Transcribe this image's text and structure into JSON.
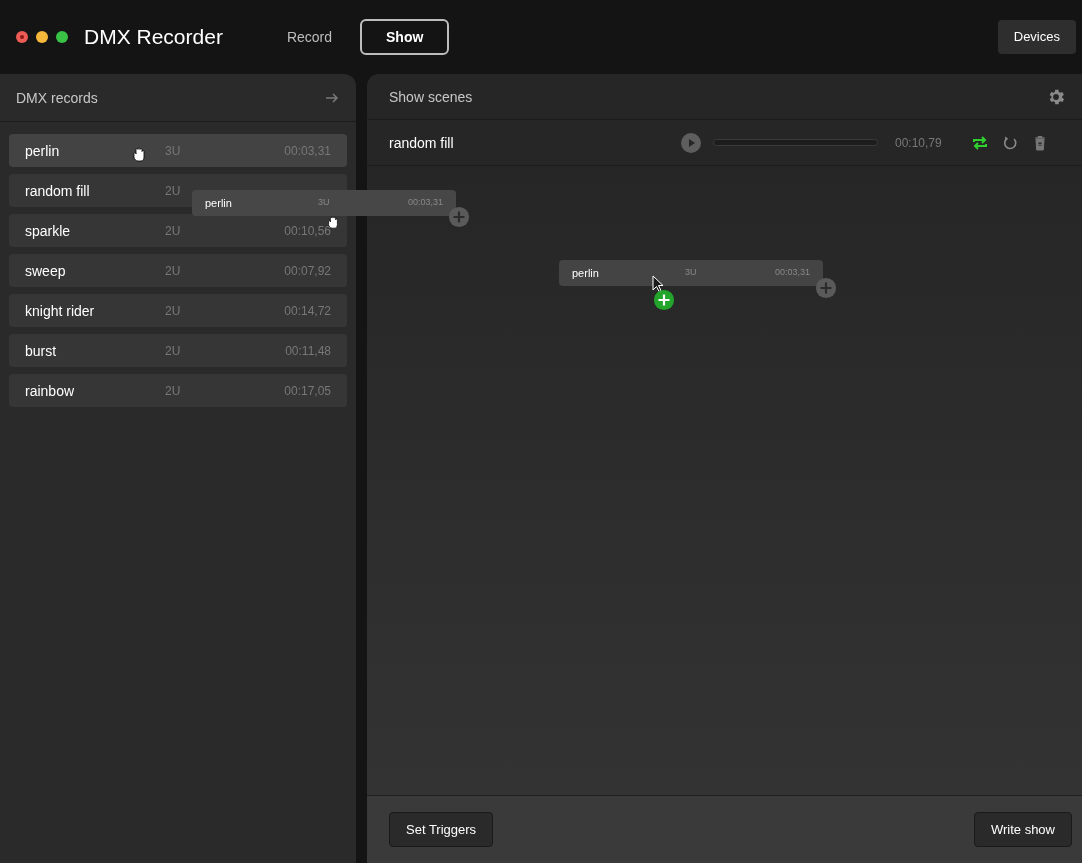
{
  "window": {
    "title": "DMX Recorder"
  },
  "nav_tabs": [
    {
      "label": "Record",
      "selected": false
    },
    {
      "label": "Show",
      "selected": true
    }
  ],
  "devices_button": "Devices",
  "records_panel": {
    "title": "DMX records",
    "records": [
      {
        "name": "perlin",
        "universes": "3U",
        "duration": "00:03,31",
        "hovered": true
      },
      {
        "name": "random fill",
        "universes": "2U",
        "hovered": false
      },
      {
        "name": "sparkle",
        "universes": "2U",
        "duration": "00:10,56",
        "hovered": false
      },
      {
        "name": "sweep",
        "universes": "2U",
        "duration": "00:07,92",
        "hovered": false
      },
      {
        "name": "knight rider",
        "universes": "2U",
        "duration": "00:14,72",
        "hovered": false
      },
      {
        "name": "burst",
        "universes": "2U",
        "duration": "00:11,48",
        "hovered": false
      },
      {
        "name": "rainbow",
        "universes": "2U",
        "duration": "00:17,05",
        "hovered": false
      }
    ]
  },
  "drag_ghost": {
    "name": "perlin",
    "universes": "3U",
    "duration": "00:03,31"
  },
  "scenes_panel": {
    "title": "Show scenes",
    "scenes": [
      {
        "name": "random fill",
        "time": "00:10,79",
        "loop": true
      }
    ],
    "canvas_items": [
      {
        "name": "perlin",
        "universes": "3U",
        "duration": "00:03,31"
      }
    ]
  },
  "footer": {
    "buttons": [
      "Set Triggers",
      "Write show"
    ]
  }
}
